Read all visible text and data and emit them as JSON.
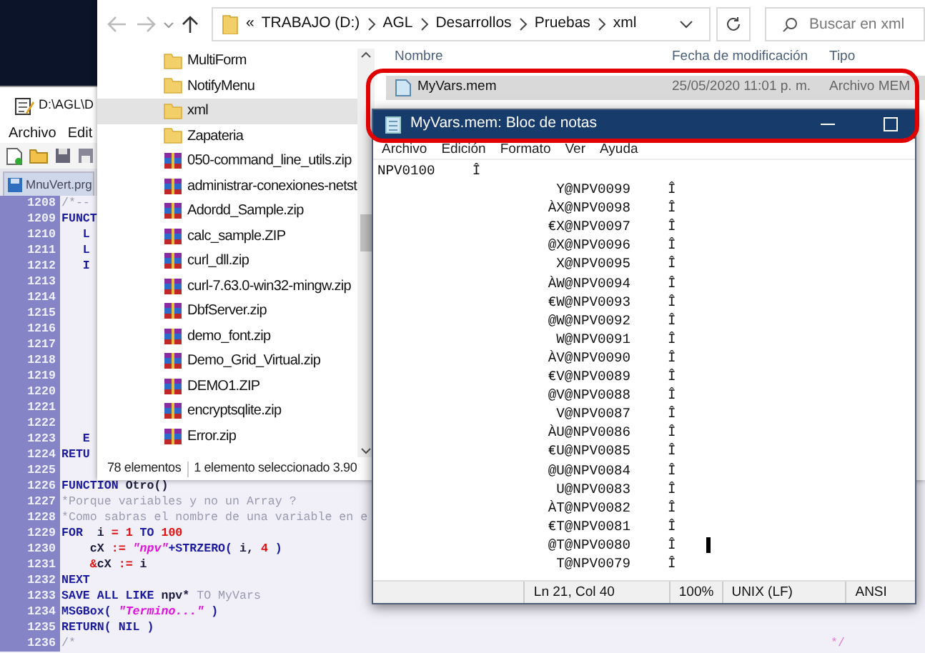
{
  "editor": {
    "title": "D:\\AGL\\D",
    "menu": [
      "Archivo",
      "Edit"
    ],
    "tabs": [
      {
        "label": "MnuVert.prg",
        "selected": true
      }
    ],
    "lines": [
      {
        "number": "1208",
        "segments": [
          {
            "text": "/*--",
            "kind": "comment"
          }
        ]
      },
      {
        "number": "1209",
        "segments": [
          {
            "text": "FUNCT",
            "kind": "keyword"
          }
        ]
      },
      {
        "number": "1210",
        "segments": [
          {
            "text": "   L",
            "kind": "keyword"
          }
        ]
      },
      {
        "number": "1211",
        "segments": [
          {
            "text": "   L",
            "kind": "keyword"
          }
        ]
      },
      {
        "number": "1212",
        "segments": [
          {
            "text": "   I",
            "kind": "keyword"
          }
        ]
      },
      {
        "number": "1213"
      },
      {
        "number": "1214"
      },
      {
        "number": "1215"
      },
      {
        "number": "1216"
      },
      {
        "number": "1217"
      },
      {
        "number": "1218"
      },
      {
        "number": "1219"
      },
      {
        "number": "1220"
      },
      {
        "number": "1221"
      },
      {
        "number": "1222"
      },
      {
        "number": "1223",
        "segments": [
          {
            "text": "   E",
            "kind": "keyword"
          }
        ]
      },
      {
        "number": "1224",
        "segments": [
          {
            "text": "RETU",
            "kind": "keyword"
          }
        ]
      },
      {
        "number": "1225"
      },
      {
        "number": "1226",
        "segments": [
          {
            "text": "FUNCTION",
            "kind": "keyword"
          },
          {
            "text": " Otro()",
            "kind": "plain"
          }
        ]
      },
      {
        "number": "1227",
        "segments": [
          {
            "text": "*Porque variables y no un Array ?",
            "kind": "comment"
          }
        ]
      },
      {
        "number": "1228",
        "segments": [
          {
            "text": "*Como sabras el nombre de una variable en e",
            "kind": "comment"
          }
        ]
      },
      {
        "number": "1229",
        "segments": [
          {
            "text": "FOR",
            "kind": "keyword"
          },
          {
            "text": "  i ",
            "kind": "plain"
          },
          {
            "text": "=",
            "kind": "op"
          },
          {
            "text": " 1 ",
            "kind": "number"
          },
          {
            "text": "TO",
            "kind": "keyword"
          },
          {
            "text": " 100",
            "kind": "number"
          }
        ]
      },
      {
        "number": "1230",
        "segments": [
          {
            "text": "    cX ",
            "kind": "plain"
          },
          {
            "text": ":=",
            "kind": "op"
          },
          {
            "text": " \"npv\"",
            "kind": "string"
          },
          {
            "text": "+STRZERO(",
            "kind": "keyword"
          },
          {
            "text": " i, ",
            "kind": "plain"
          },
          {
            "text": "4",
            "kind": "number"
          },
          {
            "text": " )",
            "kind": "keyword"
          }
        ]
      },
      {
        "number": "1231",
        "segments": [
          {
            "text": "    &",
            "kind": "op"
          },
          {
            "text": "cX ",
            "kind": "plain"
          },
          {
            "text": ":=",
            "kind": "op"
          },
          {
            "text": " i",
            "kind": "plain"
          }
        ]
      },
      {
        "number": "1232",
        "segments": [
          {
            "text": "NEXT",
            "kind": "keyword"
          }
        ]
      },
      {
        "number": "1233",
        "segments": [
          {
            "text": "SAVE ALL LIKE",
            "kind": "keyword"
          },
          {
            "text": " npv*",
            "kind": "plain"
          },
          {
            "text": " TO MyVars",
            "kind": "comment"
          }
        ]
      },
      {
        "number": "1234",
        "segments": [
          {
            "text": "MSGBox(",
            "kind": "keyword"
          },
          {
            "text": " \"Termino...\"",
            "kind": "string"
          },
          {
            "text": " )",
            "kind": "keyword"
          }
        ]
      },
      {
        "number": "1235",
        "segments": [
          {
            "text": "RETURN( NIL )",
            "kind": "keyword"
          }
        ]
      },
      {
        "number": "1236",
        "segments": [
          {
            "text": "/*",
            "kind": "comment"
          },
          {
            "text": "*/",
            "kind": "comment_end"
          }
        ]
      }
    ]
  },
  "explorer": {
    "address": {
      "overflow": "«",
      "crumbs": [
        "TRABAJO (D:)",
        "AGL",
        "Desarrollos",
        "Pruebas",
        "xml"
      ]
    },
    "search": {
      "placeholder": "Buscar en xml"
    },
    "nav_items": [
      {
        "label": "MultiForm",
        "kind": "folder",
        "selected": false
      },
      {
        "label": "NotifyMenu",
        "kind": "folder",
        "selected": false
      },
      {
        "label": "xml",
        "kind": "folder",
        "selected": true
      },
      {
        "label": "Zapateria",
        "kind": "folder",
        "selected": false
      },
      {
        "label": "050-command_line_utils.zip",
        "kind": "archive",
        "selected": false
      },
      {
        "label": "administrar-conexiones-netst",
        "kind": "archive",
        "selected": false
      },
      {
        "label": "Adordd_Sample.zip",
        "kind": "archive",
        "selected": false
      },
      {
        "label": "calc_sample.ZIP",
        "kind": "archive",
        "selected": false
      },
      {
        "label": "curl_dll.zip",
        "kind": "archive",
        "selected": false
      },
      {
        "label": "curl-7.63.0-win32-mingw.zip",
        "kind": "archive",
        "selected": false
      },
      {
        "label": "DbfServer.zip",
        "kind": "archive",
        "selected": false
      },
      {
        "label": "demo_font.zip",
        "kind": "archive",
        "selected": false
      },
      {
        "label": "Demo_Grid_Virtual.zip",
        "kind": "archive",
        "selected": false
      },
      {
        "label": "DEMO1.ZIP",
        "kind": "archive",
        "selected": false
      },
      {
        "label": "encryptsqlite.zip",
        "kind": "archive",
        "selected": false
      },
      {
        "label": "Error.zip",
        "kind": "archive",
        "selected": false
      }
    ],
    "columns": [
      "Nombre",
      "Fecha de modificación",
      "Tipo"
    ],
    "files": [
      {
        "name": "MyVars.mem",
        "modified": "25/05/2020 11:01 p. m.",
        "type": "Archivo MEM",
        "selected": true
      }
    ],
    "status": [
      "78 elementos",
      "1 elemento seleccionado 3.90"
    ]
  },
  "notepad": {
    "title": "MyVars.mem: Bloc de notas",
    "menu": [
      "Archivo",
      "Edición",
      "Formato",
      "Ver",
      "Ayuda"
    ],
    "lines": [
      {
        "text": "NPV0100",
        "mark": "Î",
        "kind": "left",
        "caret": false
      },
      {
        "text": "Y@NPV0099",
        "mark": "Î",
        "kind": "right",
        "caret": false
      },
      {
        "text": "ÀX@NPV0098",
        "mark": "Î",
        "kind": "right",
        "caret": false
      },
      {
        "text": "€X@NPV0097",
        "mark": "Î",
        "kind": "right",
        "caret": false
      },
      {
        "text": "@X@NPV0096",
        "mark": "Î",
        "kind": "right",
        "caret": false
      },
      {
        "text": "X@NPV0095",
        "mark": "Î",
        "kind": "right",
        "caret": false
      },
      {
        "text": "ÀW@NPV0094",
        "mark": "Î",
        "kind": "right",
        "caret": false
      },
      {
        "text": "€W@NPV0093",
        "mark": "Î",
        "kind": "right",
        "caret": false
      },
      {
        "text": "@W@NPV0092",
        "mark": "Î",
        "kind": "right",
        "caret": false
      },
      {
        "text": "W@NPV0091",
        "mark": "Î",
        "kind": "right",
        "caret": false
      },
      {
        "text": "ÀV@NPV0090",
        "mark": "Î",
        "kind": "right",
        "caret": false
      },
      {
        "text": "€V@NPV0089",
        "mark": "Î",
        "kind": "right",
        "caret": false
      },
      {
        "text": "@V@NPV0088",
        "mark": "Î",
        "kind": "right",
        "caret": false
      },
      {
        "text": "V@NPV0087",
        "mark": "Î",
        "kind": "right",
        "caret": false
      },
      {
        "text": "ÀU@NPV0086",
        "mark": "Î",
        "kind": "right",
        "caret": false
      },
      {
        "text": "€U@NPV0085",
        "mark": "Î",
        "kind": "right",
        "caret": false
      },
      {
        "text": "@U@NPV0084",
        "mark": "Î",
        "kind": "right",
        "caret": false
      },
      {
        "text": "U@NPV0083",
        "mark": "Î",
        "kind": "right",
        "caret": false
      },
      {
        "text": "ÀT@NPV0082",
        "mark": "Î",
        "kind": "right",
        "caret": false
      },
      {
        "text": "€T@NPV0081",
        "mark": "Î",
        "kind": "right",
        "caret": false
      },
      {
        "text": "@T@NPV0080",
        "mark": "Î",
        "kind": "right",
        "caret": true
      },
      {
        "text": "T@NPV0079",
        "mark": "Î",
        "kind": "right",
        "caret": false
      }
    ],
    "status": [
      "Ln 21, Col 40",
      "100%",
      "UNIX (LF)",
      "ANSI"
    ]
  }
}
